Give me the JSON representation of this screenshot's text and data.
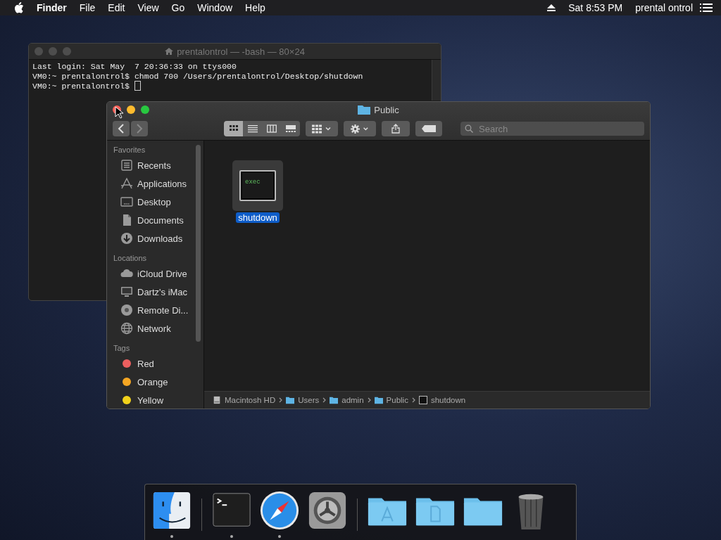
{
  "menu_bar": {
    "app": "Finder",
    "menus": [
      "File",
      "Edit",
      "View",
      "Go",
      "Window",
      "Help"
    ],
    "clock": "Sat 8:53 PM",
    "user": "prental ontrol"
  },
  "terminal": {
    "title": "prentalontrol — -bash — 80×24",
    "active": false,
    "lines": [
      "Last login: Sat May  7 20:36:33 on ttys000",
      "VM0:~ prentalontrol$ chmod 700 /Users/prentalontrol/Desktop/shutdown",
      "VM0:~ prentalontrol$ "
    ]
  },
  "finder": {
    "title": "Public",
    "active": true,
    "nav": [
      {
        "kind": "back",
        "disabled": false
      },
      {
        "kind": "forward",
        "disabled": true
      }
    ],
    "views": [
      {
        "kind": "icons",
        "selected": true
      },
      {
        "kind": "list",
        "selected": false
      },
      {
        "kind": "columns",
        "selected": false
      },
      {
        "kind": "gallery",
        "selected": false
      }
    ],
    "search": {
      "placeholder": "Search"
    },
    "sidebar": [
      {
        "heading": "Favorites",
        "items": [
          {
            "label": "Recents",
            "kind": "recents"
          },
          {
            "label": "Applications",
            "kind": "apps"
          },
          {
            "label": "Desktop",
            "kind": "desktop"
          },
          {
            "label": "Documents",
            "kind": "documents"
          },
          {
            "label": "Downloads",
            "kind": "downloads"
          }
        ]
      },
      {
        "heading": "Locations",
        "items": [
          {
            "label": "iCloud Drive",
            "kind": "cloud"
          },
          {
            "label": "Dartz's iMac",
            "kind": "computer"
          },
          {
            "label": "Remote Di...",
            "kind": "disc"
          },
          {
            "label": "Network",
            "kind": "network"
          }
        ]
      },
      {
        "heading": "Tags",
        "items": [
          {
            "label": "Red",
            "kind": "tag",
            "color": "#ec5f5f"
          },
          {
            "label": "Orange",
            "kind": "tag",
            "color": "#f5a623"
          },
          {
            "label": "Yellow",
            "kind": "tag",
            "color": "#f2d21b"
          }
        ]
      }
    ],
    "files": [
      {
        "name": "shutdown",
        "badge": "exec",
        "selected": true
      }
    ],
    "path": [
      {
        "label": "Macintosh HD",
        "kind": "disk"
      },
      {
        "label": "Users",
        "kind": "folder"
      },
      {
        "label": "admin",
        "kind": "folder"
      },
      {
        "label": "Public",
        "kind": "folder"
      },
      {
        "label": "shutdown",
        "kind": "exec"
      }
    ]
  },
  "dock": [
    [
      {
        "kind": "finder",
        "running": true
      }
    ],
    [
      {
        "kind": "terminal",
        "running": true
      },
      {
        "kind": "safari",
        "running": true
      },
      {
        "kind": "prefs",
        "running": false
      }
    ],
    [
      {
        "kind": "folder-apps",
        "running": false
      },
      {
        "kind": "folder-docs",
        "running": false
      },
      {
        "kind": "folder",
        "running": false
      },
      {
        "kind": "trash",
        "running": false
      }
    ]
  ]
}
